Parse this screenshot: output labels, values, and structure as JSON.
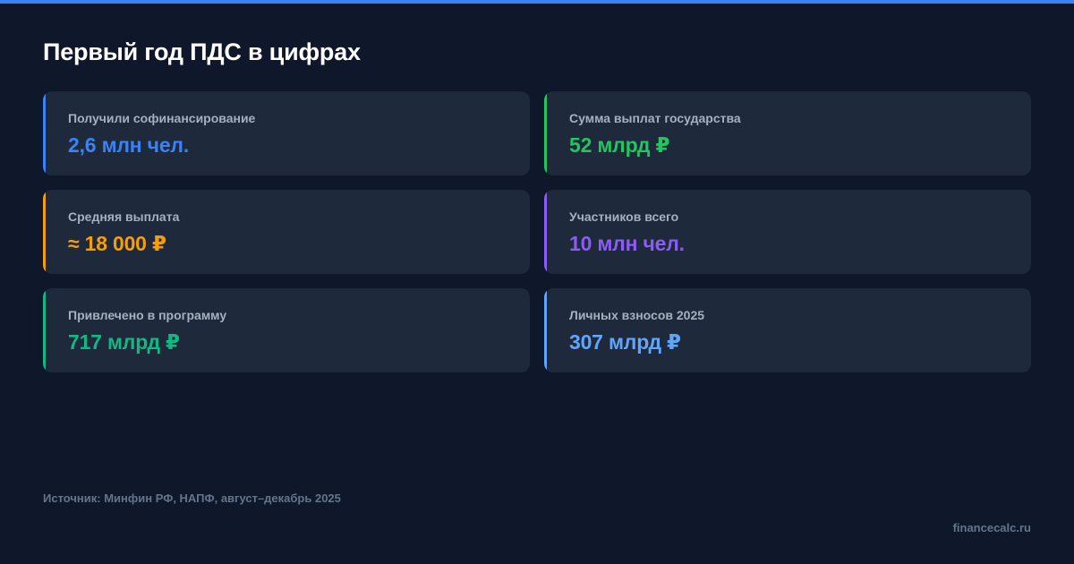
{
  "colors": {
    "background": "#0f172a",
    "card": "#1e293b",
    "top_bar": "#3b82f6",
    "label": "#a6b0bf",
    "muted": "#64748b"
  },
  "title": "Первый год ПДС в цифрах",
  "cards": [
    {
      "label": "Получили софинансирование",
      "value": "2,6 млн чел.",
      "color": "#3b82f6"
    },
    {
      "label": "Сумма выплат государства",
      "value": "52 млрд ₽",
      "color": "#22c55e"
    },
    {
      "label": "Средняя выплата",
      "value": "≈ 18 000 ₽",
      "color": "#f59e0b"
    },
    {
      "label": "Участников всего",
      "value": "10 млн чел.",
      "color": "#8b5cf6"
    },
    {
      "label": "Привлечено в программу",
      "value": "717 млрд ₽",
      "color": "#10b981"
    },
    {
      "label": "Личных взносов 2025",
      "value": "307 млрд ₽",
      "color": "#60a5fa"
    }
  ],
  "source": "Источник: Минфин РФ, НАПФ, август–декабрь 2025",
  "watermark": "financecalc.ru"
}
